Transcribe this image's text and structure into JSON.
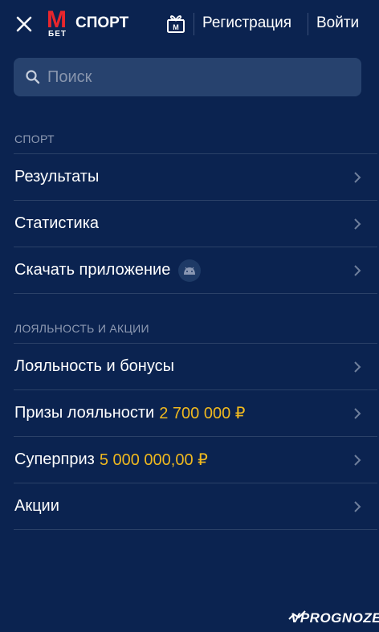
{
  "header": {
    "logo_m": "M",
    "logo_bet": "БЕТ",
    "logo_sport": "СПОРТ",
    "register_label": "Регистрация",
    "login_label": "Войти"
  },
  "search": {
    "placeholder": "Поиск"
  },
  "sections": [
    {
      "title": "СПОРТ",
      "items": [
        {
          "label": "Результаты"
        },
        {
          "label": "Статистика"
        },
        {
          "label": "Скачать приложение",
          "badge_icon": "android-icon"
        }
      ]
    },
    {
      "title": "ЛОЯЛЬНОСТЬ И АКЦИИ",
      "items": [
        {
          "label": "Лояльность и бонусы"
        },
        {
          "label": "Призы лояльности",
          "amount": "2 700 000 ₽"
        },
        {
          "label": "Суперприз",
          "amount": "5 000 000,00 ₽"
        },
        {
          "label": "Акции"
        }
      ]
    }
  ],
  "watermark": "VPROGNOZE",
  "colors": {
    "background": "#0b2350",
    "brand_red": "#e8262d",
    "amount_yellow": "#f0b91f",
    "search_bg": "#27426e"
  }
}
